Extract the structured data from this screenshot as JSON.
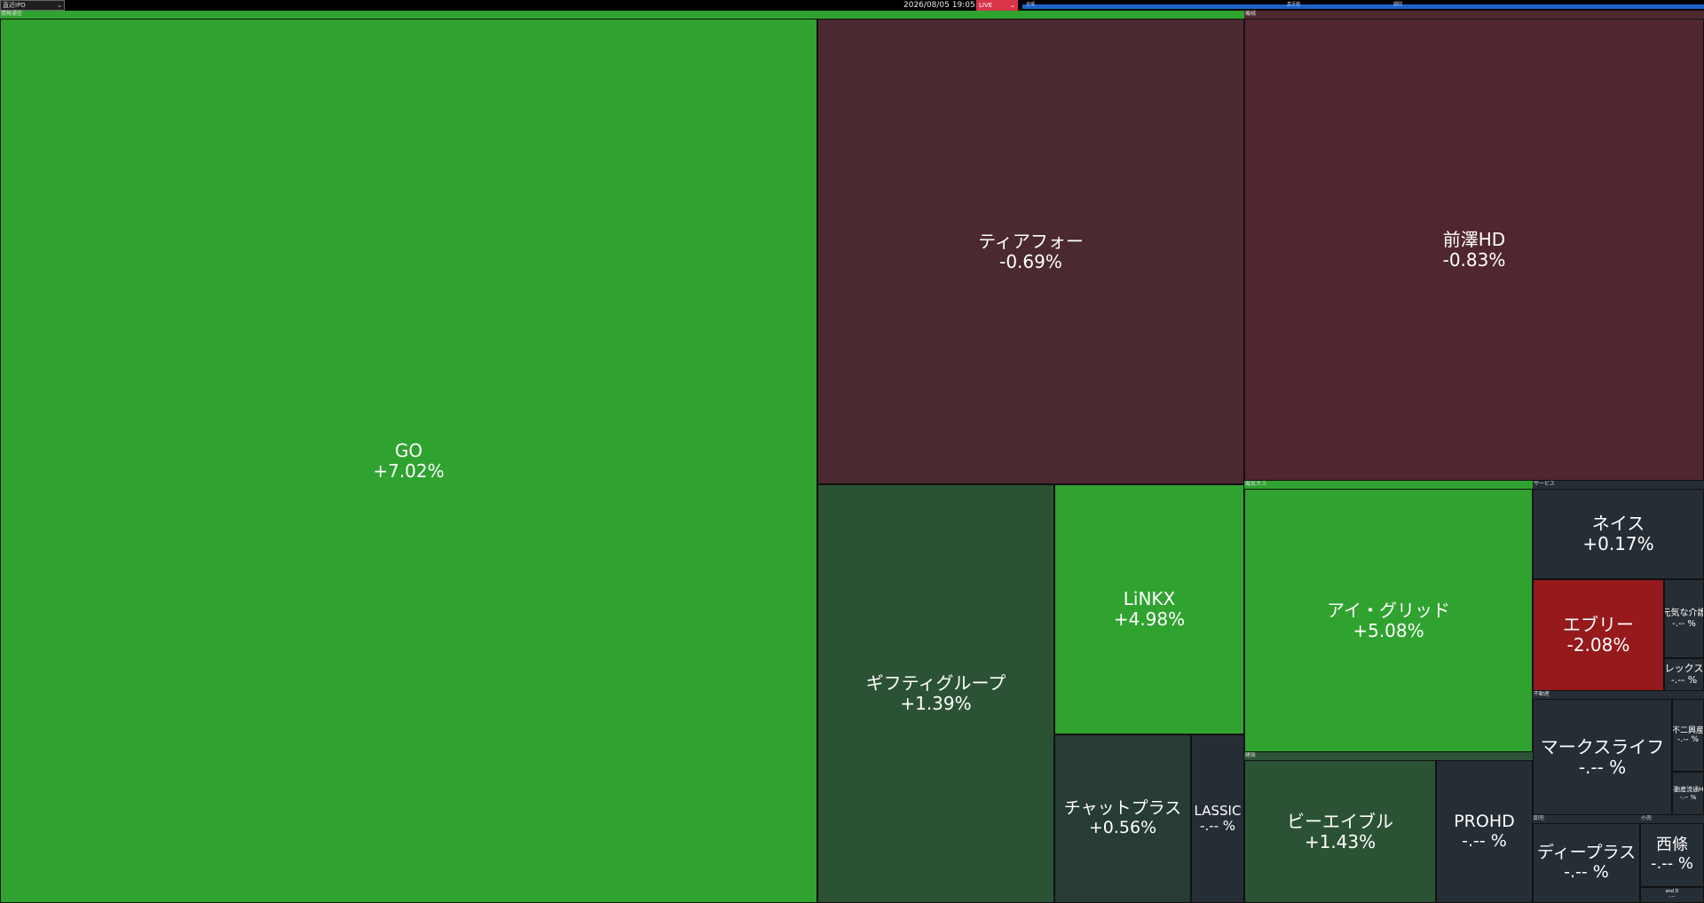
{
  "toolbar": {
    "view_select": "直近IPO",
    "timestamp": "2026/08/05 19:05:04",
    "mode_select": "LIVE",
    "range_labels": [
      "全域",
      "直近値",
      "期間"
    ]
  },
  "colors": {
    "strong_up": "#30a230",
    "mild_up": "#2c5235",
    "flat": "#262e35",
    "mild_down": "#4a2930",
    "down": "#502630",
    "strong_down": "#96191c"
  },
  "treemap": {
    "sectors": [
      {
        "label": "情報通信"
      },
      {
        "label": "機械"
      },
      {
        "label": "電気ガス"
      },
      {
        "label": "サービス"
      },
      {
        "label": "不動産"
      },
      {
        "label": "建設"
      },
      {
        "label": "卸売"
      },
      {
        "label": "小売"
      }
    ],
    "tiles": [
      {
        "name": "GO",
        "change": "+7.02%",
        "color": "#30a230"
      },
      {
        "name": "ティアフォー",
        "change": "-0.69%",
        "color": "#4a2930"
      },
      {
        "name": "前澤HD",
        "change": "-0.83%",
        "color": "#502630"
      },
      {
        "name": "ギフティグループ",
        "change": "+1.39%",
        "color": "#2c5235"
      },
      {
        "name": "LiNKX",
        "change": "+4.98%",
        "color": "#30a230"
      },
      {
        "name": "チャットプラス",
        "change": "+0.56%",
        "color": "#283c37"
      },
      {
        "name": "LASSIC",
        "change": "-.-- %",
        "color": "#262e35"
      },
      {
        "name": "アイ・グリッド",
        "change": "+5.08%",
        "color": "#30a230"
      },
      {
        "name": "ビーエイブル",
        "change": "+1.43%",
        "color": "#2c5235"
      },
      {
        "name": "PROHD",
        "change": "-.-- %",
        "color": "#262e35"
      },
      {
        "name": "ネイス",
        "change": "+0.17%",
        "color": "#262e35"
      },
      {
        "name": "エブリー",
        "change": "-2.08%",
        "color": "#96191c"
      },
      {
        "name": "元気な介護",
        "change": "-.-- %",
        "color": "#262e35"
      },
      {
        "name": "レックス",
        "change": "-.-- %",
        "color": "#262e35"
      },
      {
        "name": "マークスライフ",
        "change": "-.-- %",
        "color": "#262e35"
      },
      {
        "name": "不二興産",
        "change": "-.-- %",
        "color": "#262e35"
      },
      {
        "name": "不動産流通HD",
        "change": "-.-- %",
        "color": "#262e35"
      },
      {
        "name": "ディープラス",
        "change": "-.-- %",
        "color": "#262e35"
      },
      {
        "name": "西條",
        "change": "-.-- %",
        "color": "#262e35"
      },
      {
        "name": "and D",
        "change": "-.--",
        "color": "#262e35"
      }
    ]
  }
}
